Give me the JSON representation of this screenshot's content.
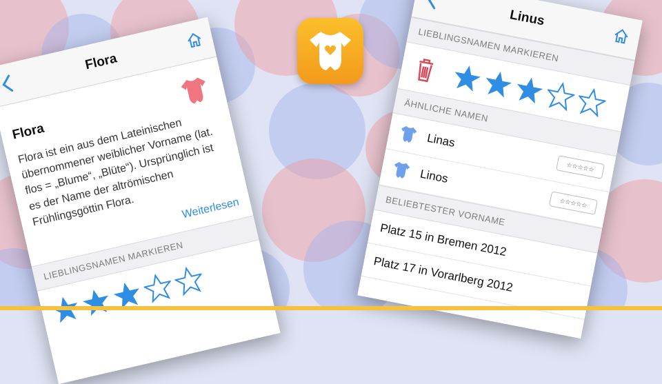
{
  "colors": {
    "accent": "#2f8de4",
    "star": "#2f8de4",
    "trash": "#d64a5a",
    "onesie_pink": "#ef7681",
    "onesie_blue": "#6fa0ea",
    "app_icon": "#f6b02a",
    "bottom_bar": "#f6c23e"
  },
  "left_screen": {
    "title": "Flora",
    "back_icon": "chevron-left-icon",
    "home_icon": "home-icon",
    "detail_title": "Flora",
    "detail_text": "Flora ist ein aus dem Lateinischen übernommener weiblicher Vorname (lat. flos = „Blume“, „Blüte“). Ursprünglich ist es der Name der altrömischen Frühlingsgöttin Flora.",
    "read_more": "Weiterlesen",
    "section_favorites": "LIEBLINGSNAMEN MARKIEREN",
    "rating": 3,
    "rating_max": 5
  },
  "right_screen": {
    "title": "Linus",
    "back_icon": "chevron-left-icon",
    "home_icon": "home-icon",
    "section_favorites": "LIEBLINGSNAMEN MARKIEREN",
    "trash_icon": "trash-icon",
    "rating": 3,
    "rating_max": 5,
    "section_similar": "ÄHNLICHE NAMEN",
    "similar_names": [
      {
        "name": "Linas",
        "rating": "☆☆☆☆☆"
      },
      {
        "name": "Linos",
        "rating": "☆☆☆☆☆"
      }
    ],
    "section_popular": "BELIEBTESTER VORNAME",
    "popular": [
      "Platz 15 in Bremen 2012",
      "Platz 17 in Vorarlberg 2012"
    ]
  }
}
